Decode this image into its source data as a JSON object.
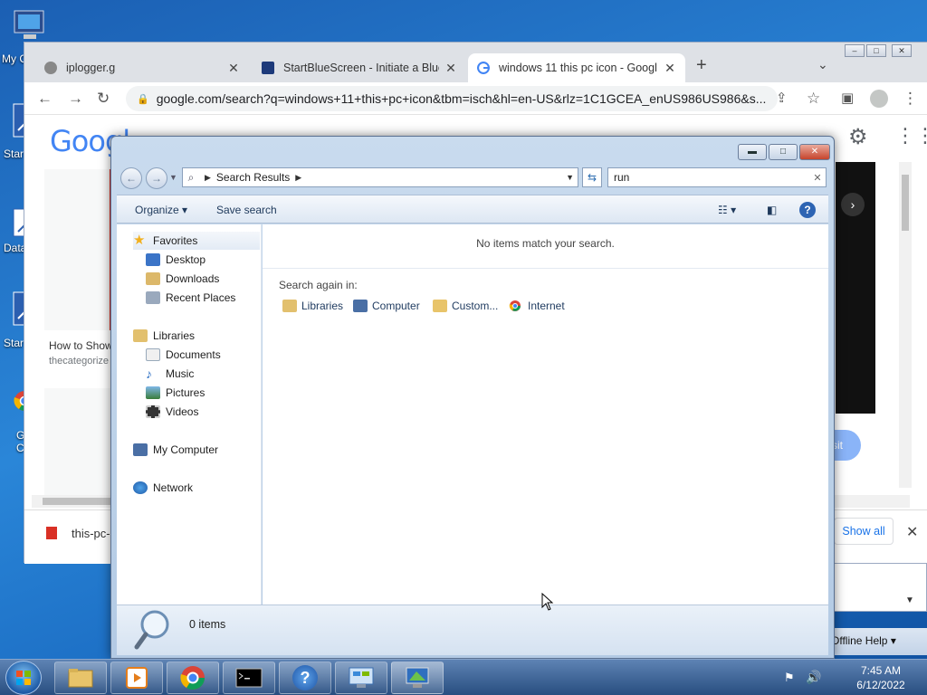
{
  "desktop": {
    "icons": [
      {
        "label": "My C"
      },
      {
        "label": "Star"
      },
      {
        "label": "Data"
      },
      {
        "label": "Star"
      },
      {
        "label": "G"
      },
      {
        "label": "C"
      }
    ]
  },
  "chrome": {
    "tabs": [
      {
        "title": "iplogger.g",
        "active": false
      },
      {
        "title": "StartBlueScreen - Initiate a Blue S",
        "active": false
      },
      {
        "title": "windows 11 this pc icon - Googl",
        "active": true
      }
    ],
    "url": "google.com/search?q=windows+11+this+pc+icon&tbm=isch&hl=en-US&rlz=1C1GCEA_enUS986US986&s...",
    "page": {
      "google_logo": "Googl",
      "result_caption": "How to Show",
      "result_source": "thecategorize",
      "visit_label": "sit",
      "download_item": "this-pc-",
      "show_all": "Show all",
      "offline_help": "Offline Help"
    }
  },
  "explorer": {
    "breadcrumb": "Search Results",
    "search_value": "run",
    "toolbar": {
      "organize": "Organize",
      "save_search": "Save search"
    },
    "nav": {
      "favorites": "Favorites",
      "favorites_items": [
        "Desktop",
        "Downloads",
        "Recent Places"
      ],
      "libraries": "Libraries",
      "libraries_items": [
        "Documents",
        "Music",
        "Pictures",
        "Videos"
      ],
      "my_computer": "My Computer",
      "network": "Network"
    },
    "content": {
      "no_items": "No items match your search.",
      "search_again": "Search again in:",
      "locations": [
        "Libraries",
        "Computer",
        "Custom...",
        "Internet"
      ]
    },
    "status": "0 items"
  },
  "taskbar": {
    "time": "7:45 AM",
    "date": "6/12/2022"
  }
}
